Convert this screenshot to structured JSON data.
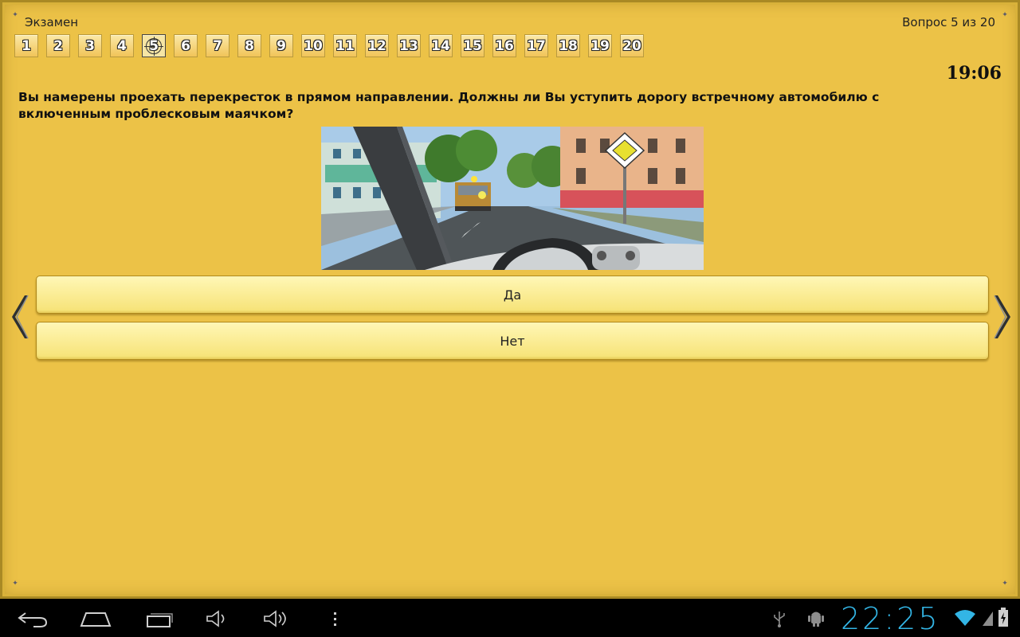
{
  "header": {
    "title": "Экзамен",
    "progress_text": "Вопрос 5 из 20"
  },
  "question_nav": {
    "items": [
      "1",
      "2",
      "3",
      "4",
      "5",
      "6",
      "7",
      "8",
      "9",
      "10",
      "11",
      "12",
      "13",
      "14",
      "15",
      "16",
      "17",
      "18",
      "19",
      "20"
    ],
    "current_index": 4
  },
  "timer": "19:06",
  "question": {
    "text": "Вы намерены проехать перекресток в прямом направлении. Должны ли Вы уступить дорогу встречному автомобилю с включенным проблесковым маячком?"
  },
  "answers": [
    "Да",
    "Нет"
  ],
  "icons": {
    "prev": "chevron-left-icon",
    "next": "chevron-right-icon",
    "sign": "main-road-sign-icon",
    "back": "back-icon",
    "home": "home-icon",
    "recents": "recent-apps-icon",
    "vol_down": "volume-down-icon",
    "vol_up": "volume-up-icon",
    "menu": "overflow-menu-icon",
    "usb": "usb-icon",
    "debug": "android-debug-icon",
    "wifi": "wifi-icon",
    "battery": "battery-charging-icon"
  },
  "colors": {
    "background": "#ecc247",
    "answer_button": "#f6e275",
    "clock": "#33b5e5"
  },
  "system_bar": {
    "clock": "22:25"
  }
}
